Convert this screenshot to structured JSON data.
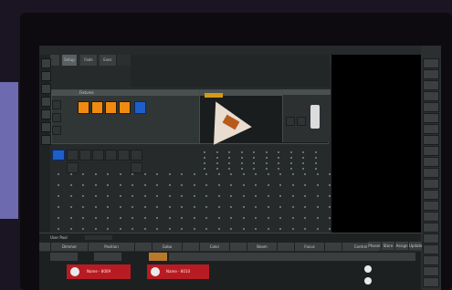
{
  "toolbar": {
    "tabs": [
      "",
      "Setup",
      "Fade",
      "Exec"
    ]
  },
  "fixtures_window": {
    "title": "Fixtures"
  },
  "color_window": {
    "title": ""
  },
  "layout_window": {
    "title": ""
  },
  "command_line": {
    "label": "User Pool",
    "value": ""
  },
  "attribute_tabs": [
    "",
    "Dimmer",
    "Position",
    "",
    "Gobo",
    "",
    "Color",
    "",
    "Beam",
    "",
    "Focus",
    "",
    "Control"
  ],
  "executors": [
    {
      "label": "Name - 8009"
    },
    {
      "label": "Name - 8010"
    }
  ],
  "right_bar": {
    "buttons": [
      "",
      "",
      "",
      "",
      "",
      "",
      "",
      "",
      "",
      "",
      "",
      "",
      "",
      "",
      "",
      "",
      "",
      "",
      "",
      "",
      ""
    ],
    "bottom_tabs": [
      "Phaser",
      "Store",
      "Assign",
      "Update"
    ]
  },
  "colors": {
    "accent_blue": "#1e5ec8",
    "swatch_orange": "#f08a10",
    "exec_red": "#b81c22",
    "panel": "#262a2b"
  }
}
